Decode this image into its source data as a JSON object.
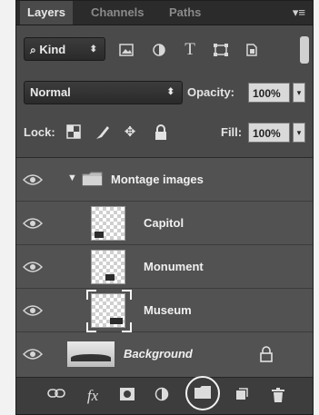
{
  "tabs": [
    {
      "label": "Layers",
      "active": true
    },
    {
      "label": "Channels",
      "active": false
    },
    {
      "label": "Paths",
      "active": false
    }
  ],
  "panel_menu_icon": "panel-menu-icon",
  "filter": {
    "kind_label": "Kind",
    "icons": [
      "pixel-filter-icon",
      "adjustment-filter-icon",
      "type-filter-icon",
      "shape-filter-icon",
      "smart-object-filter-icon"
    ],
    "type_glyph": "T"
  },
  "blend": {
    "mode": "Normal",
    "opacity_label": "Opacity:",
    "opacity_value": "100%"
  },
  "lock": {
    "label": "Lock:",
    "fill_label": "Fill:",
    "fill_value": "100%"
  },
  "layers": [
    {
      "name": "Montage images",
      "type": "group",
      "expanded": true
    },
    {
      "name": "Capitol",
      "type": "pixel"
    },
    {
      "name": "Monument",
      "type": "pixel"
    },
    {
      "name": "Museum",
      "type": "pixel",
      "selected": true
    },
    {
      "name": "Background",
      "type": "background",
      "locked": true
    }
  ],
  "toolbar": {
    "fx_label": "fx",
    "icons": [
      "link-layers-icon",
      "fx-icon",
      "mask-icon",
      "adjustment-layer-icon",
      "new-group-icon",
      "new-layer-icon",
      "trash-icon"
    ],
    "highlighted": "new-group-icon"
  },
  "colors": {
    "panel_bg": "#4a4a4a",
    "tabbar_bg": "#2b2b2b",
    "highlight_ring": "#f2f2f2"
  }
}
